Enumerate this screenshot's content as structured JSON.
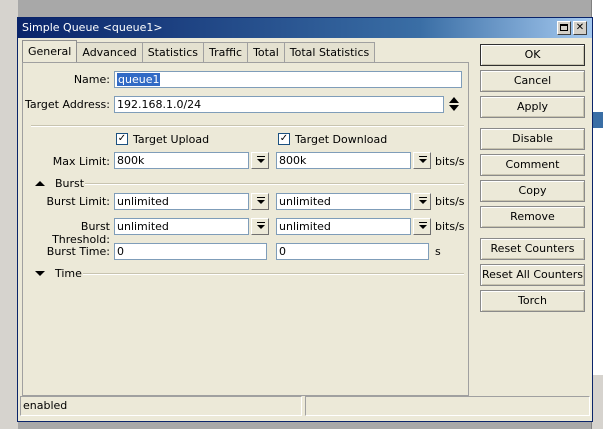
{
  "window": {
    "title": "Simple Queue <queue1>"
  },
  "tabs": [
    {
      "label": "General"
    },
    {
      "label": "Advanced"
    },
    {
      "label": "Statistics"
    },
    {
      "label": "Traffic"
    },
    {
      "label": "Total"
    },
    {
      "label": "Total Statistics"
    }
  ],
  "general": {
    "name_label": "Name:",
    "name_value": "queue1",
    "target_address_label": "Target Address:",
    "target_address_value": "192.168.1.0/24",
    "target_upload_label": "Target Upload",
    "target_upload_checked": true,
    "target_download_label": "Target Download",
    "target_download_checked": true,
    "max_limit_label": "Max Limit:",
    "max_limit_upload": "800k",
    "max_limit_download": "800k",
    "unit_bits": "bits/s",
    "unit_s": "s",
    "burst_header": "Burst",
    "burst_limit_label": "Burst Limit:",
    "burst_limit_upload": "unlimited",
    "burst_limit_download": "unlimited",
    "burst_threshold_label": "Burst Threshold:",
    "burst_threshold_upload": "unlimited",
    "burst_threshold_download": "unlimited",
    "burst_time_label": "Burst Time:",
    "burst_time_upload": "0",
    "burst_time_download": "0",
    "time_header": "Time"
  },
  "buttons": {
    "ok": "OK",
    "cancel": "Cancel",
    "apply": "Apply",
    "disable": "Disable",
    "comment": "Comment",
    "copy": "Copy",
    "remove": "Remove",
    "reset_counters": "Reset Counters",
    "reset_all_counters": "Reset All Counters",
    "torch": "Torch"
  },
  "status": {
    "state": "enabled"
  },
  "icons": {
    "maximize": "maximize-icon",
    "close": "close-icon",
    "dropdown": "dropdown-arrow-icon",
    "updown": "up-down-arrow-icon",
    "collapse": "collapse-triangle-icon",
    "expand": "expand-triangle-icon",
    "check": "checkmark-icon"
  },
  "colors": {
    "titlebar": "#0a246a",
    "dialog_bg": "#ece9d8",
    "selection": "#316ac5"
  }
}
